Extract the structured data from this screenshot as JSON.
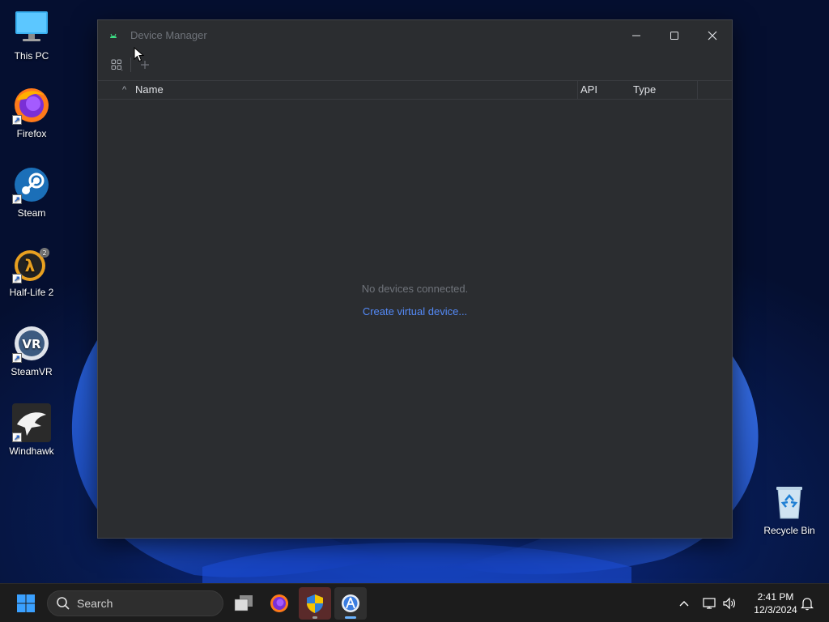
{
  "desktop": {
    "icons": [
      {
        "label": "This PC",
        "icon": "monitor-icon"
      },
      {
        "label": "Firefox",
        "icon": "firefox-icon"
      },
      {
        "label": "Steam",
        "icon": "steam-icon"
      },
      {
        "label": "Half-Life 2",
        "icon": "half-life-2-icon"
      },
      {
        "label": "SteamVR",
        "icon": "steamvr-icon"
      },
      {
        "label": "Windhawk",
        "icon": "windhawk-icon"
      },
      {
        "label": "Recycle Bin",
        "icon": "recycle-bin-icon"
      }
    ]
  },
  "window": {
    "title": "Device Manager",
    "toolbar": {
      "items": [
        {
          "name": "device-grid-menu",
          "icon": "grid-icon"
        },
        {
          "name": "add-device",
          "icon": "plus-icon"
        }
      ]
    },
    "table": {
      "columns": [
        "Name",
        "API",
        "Type"
      ],
      "sort_indicator": "^"
    },
    "empty_state": {
      "message": "No devices connected.",
      "action": "Create virtual device..."
    }
  },
  "taskbar": {
    "search_placeholder": "Search",
    "apps": [
      {
        "name": "task-view",
        "icon": "task-view-icon"
      },
      {
        "name": "firefox",
        "icon": "firefox-icon"
      },
      {
        "name": "security",
        "icon": "shield-icon"
      },
      {
        "name": "android-studio",
        "icon": "android-studio-icon"
      }
    ],
    "clock": {
      "time": "2:41 PM",
      "date": "12/3/2024"
    }
  },
  "colors": {
    "window_bg": "#2b2d30",
    "link": "#548af7",
    "muted_text": "#6f737a",
    "taskbar_bg": "#1c1c1c"
  }
}
